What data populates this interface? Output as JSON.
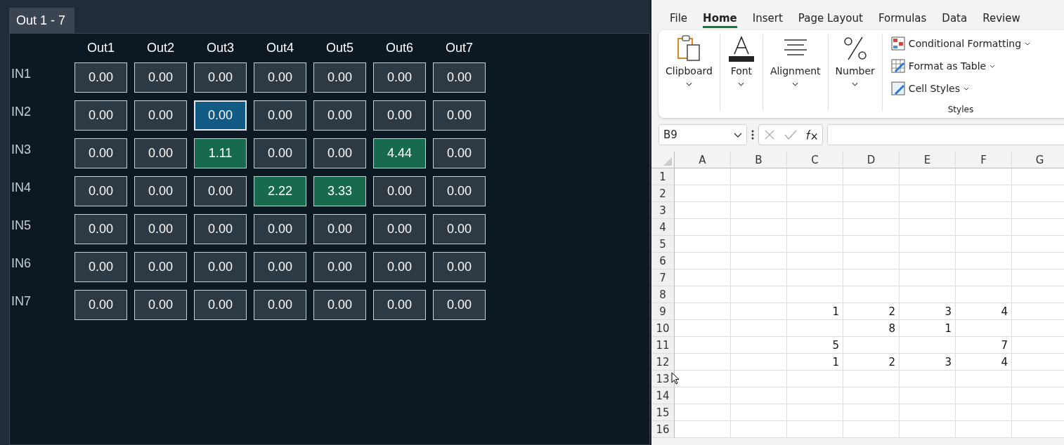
{
  "matrix_panel": {
    "tabs": [
      {
        "label": "Out 1 - 7",
        "selected": true
      }
    ],
    "columns": [
      "Out1",
      "Out2",
      "Out3",
      "Out4",
      "Out5",
      "Out6",
      "Out7"
    ],
    "rows": [
      {
        "label": "IN1",
        "cells": [
          {
            "value": "0.00",
            "selected": false,
            "active": false
          },
          {
            "value": "0.00",
            "selected": false,
            "active": false
          },
          {
            "value": "0.00",
            "selected": false,
            "active": false
          },
          {
            "value": "0.00",
            "selected": false,
            "active": false
          },
          {
            "value": "0.00",
            "selected": false,
            "active": false
          },
          {
            "value": "0.00",
            "selected": false,
            "active": false
          },
          {
            "value": "0.00",
            "selected": false,
            "active": false
          }
        ]
      },
      {
        "label": "IN2",
        "cells": [
          {
            "value": "0.00",
            "selected": false,
            "active": false
          },
          {
            "value": "0.00",
            "selected": false,
            "active": false
          },
          {
            "value": "0.00",
            "selected": true,
            "active": false
          },
          {
            "value": "0.00",
            "selected": false,
            "active": false
          },
          {
            "value": "0.00",
            "selected": false,
            "active": false
          },
          {
            "value": "0.00",
            "selected": false,
            "active": false
          },
          {
            "value": "0.00",
            "selected": false,
            "active": false
          }
        ]
      },
      {
        "label": "IN3",
        "cells": [
          {
            "value": "0.00",
            "selected": false,
            "active": false
          },
          {
            "value": "0.00",
            "selected": false,
            "active": false
          },
          {
            "value": "1.11",
            "selected": false,
            "active": true
          },
          {
            "value": "0.00",
            "selected": false,
            "active": false
          },
          {
            "value": "0.00",
            "selected": false,
            "active": false
          },
          {
            "value": "4.44",
            "selected": false,
            "active": true
          },
          {
            "value": "0.00",
            "selected": false,
            "active": false
          }
        ]
      },
      {
        "label": "IN4",
        "cells": [
          {
            "value": "0.00",
            "selected": false,
            "active": false
          },
          {
            "value": "0.00",
            "selected": false,
            "active": false
          },
          {
            "value": "0.00",
            "selected": false,
            "active": false
          },
          {
            "value": "2.22",
            "selected": false,
            "active": true
          },
          {
            "value": "3.33",
            "selected": false,
            "active": true
          },
          {
            "value": "0.00",
            "selected": false,
            "active": false
          },
          {
            "value": "0.00",
            "selected": false,
            "active": false
          }
        ]
      },
      {
        "label": "IN5",
        "cells": [
          {
            "value": "0.00",
            "selected": false,
            "active": false
          },
          {
            "value": "0.00",
            "selected": false,
            "active": false
          },
          {
            "value": "0.00",
            "selected": false,
            "active": false
          },
          {
            "value": "0.00",
            "selected": false,
            "active": false
          },
          {
            "value": "0.00",
            "selected": false,
            "active": false
          },
          {
            "value": "0.00",
            "selected": false,
            "active": false
          },
          {
            "value": "0.00",
            "selected": false,
            "active": false
          }
        ]
      },
      {
        "label": "IN6",
        "cells": [
          {
            "value": "0.00",
            "selected": false,
            "active": false
          },
          {
            "value": "0.00",
            "selected": false,
            "active": false
          },
          {
            "value": "0.00",
            "selected": false,
            "active": false
          },
          {
            "value": "0.00",
            "selected": false,
            "active": false
          },
          {
            "value": "0.00",
            "selected": false,
            "active": false
          },
          {
            "value": "0.00",
            "selected": false,
            "active": false
          },
          {
            "value": "0.00",
            "selected": false,
            "active": false
          }
        ]
      },
      {
        "label": "IN7",
        "cells": [
          {
            "value": "0.00",
            "selected": false,
            "active": false
          },
          {
            "value": "0.00",
            "selected": false,
            "active": false
          },
          {
            "value": "0.00",
            "selected": false,
            "active": false
          },
          {
            "value": "0.00",
            "selected": false,
            "active": false
          },
          {
            "value": "0.00",
            "selected": false,
            "active": false
          },
          {
            "value": "0.00",
            "selected": false,
            "active": false
          },
          {
            "value": "0.00",
            "selected": false,
            "active": false
          }
        ]
      }
    ]
  },
  "spreadsheet": {
    "ribbon_tabs": [
      {
        "label": "File",
        "selected": false
      },
      {
        "label": "Home",
        "selected": true
      },
      {
        "label": "Insert",
        "selected": false
      },
      {
        "label": "Page Layout",
        "selected": false
      },
      {
        "label": "Formulas",
        "selected": false
      },
      {
        "label": "Data",
        "selected": false
      },
      {
        "label": "Review",
        "selected": false
      }
    ],
    "ribbon_groups": [
      {
        "kind": "clipboard",
        "label": "Clipboard"
      },
      {
        "kind": "font",
        "label": "Font"
      },
      {
        "kind": "alignment",
        "label": "Alignment"
      },
      {
        "kind": "number",
        "label": "Number"
      }
    ],
    "styles_group": {
      "label": "Styles",
      "commands": [
        {
          "kind": "conditional",
          "label": "Conditional Formatting"
        },
        {
          "kind": "table",
          "label": "Format as Table"
        },
        {
          "kind": "cellstyles",
          "label": "Cell Styles"
        }
      ]
    },
    "name_box": "B9",
    "columns": [
      "A",
      "B",
      "C",
      "D",
      "E",
      "F",
      "G"
    ],
    "rows": [
      {
        "header": "1",
        "cells": {}
      },
      {
        "header": "2",
        "cells": {}
      },
      {
        "header": "3",
        "cells": {}
      },
      {
        "header": "4",
        "cells": {}
      },
      {
        "header": "5",
        "cells": {}
      },
      {
        "header": "6",
        "cells": {}
      },
      {
        "header": "7",
        "cells": {}
      },
      {
        "header": "8",
        "cells": {}
      },
      {
        "header": "9",
        "cells": {
          "col_3": "1",
          "col_4": "2",
          "col_5": "3",
          "col_6": "4"
        }
      },
      {
        "header": "10",
        "cells": {
          "col_4": "8",
          "col_5": "1"
        }
      },
      {
        "header": "11",
        "cells": {
          "col_3": "5",
          "col_6": "7"
        }
      },
      {
        "header": "12",
        "cells": {
          "col_3": "1",
          "col_4": "2",
          "col_5": "3",
          "col_6": "4"
        }
      },
      {
        "header": "13",
        "cells": {}
      },
      {
        "header": "14",
        "cells": {}
      },
      {
        "header": "15",
        "cells": {}
      },
      {
        "header": "16",
        "cells": {}
      }
    ]
  }
}
